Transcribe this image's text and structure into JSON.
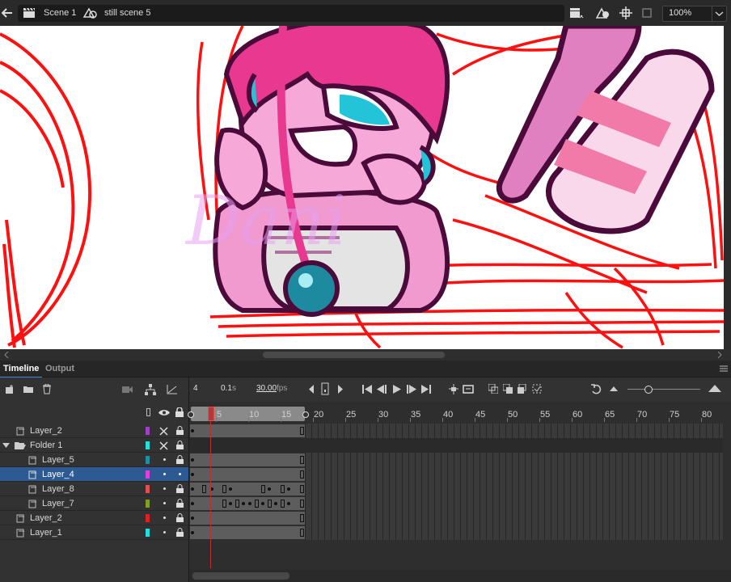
{
  "header": {
    "scene_label": "Scene 1",
    "symbol_label": "still scene 5",
    "zoom_value": "100%"
  },
  "stage": {
    "watermark": "Dani"
  },
  "tabs": [
    {
      "label": "Timeline",
      "active": true
    },
    {
      "label": "Output",
      "active": false
    }
  ],
  "timeline": {
    "current_frame": "4",
    "elapsed_time": "0.1",
    "time_unit": "s",
    "frame_rate": "30.00",
    "fps_unit": "fps",
    "ruler_ticks": [
      "5",
      "10",
      "15",
      "20",
      "25",
      "30",
      "35",
      "40",
      "45",
      "50",
      "55",
      "60",
      "65",
      "70",
      "75",
      "80"
    ],
    "layers": [
      {
        "name": "Layer_2",
        "indent": 0,
        "type": "layer",
        "color": "#a040c8",
        "visibility": "x",
        "lock": true,
        "selected": false
      },
      {
        "name": "Folder 1",
        "indent": 0,
        "type": "folder",
        "color": "#20e0e0",
        "visibility": "x",
        "lock": true,
        "selected": false
      },
      {
        "name": "Layer_5",
        "indent": 1,
        "type": "layer",
        "color": "#2090a0",
        "visibility": "dot",
        "lock": true,
        "selected": false
      },
      {
        "name": "Layer_4",
        "indent": 1,
        "type": "layer",
        "color": "#e040e0",
        "visibility": "dot",
        "lock": false,
        "selected": true
      },
      {
        "name": "Layer_8",
        "indent": 1,
        "type": "layer",
        "color": "#e05050",
        "visibility": "dot",
        "lock": true,
        "selected": false
      },
      {
        "name": "Layer_7",
        "indent": 1,
        "type": "layer",
        "color": "#80a020",
        "visibility": "dot",
        "lock": true,
        "selected": false
      },
      {
        "name": "Layer_2",
        "indent": 0,
        "type": "layer",
        "color": "#e02020",
        "visibility": "dot",
        "lock": true,
        "selected": false
      },
      {
        "name": "Layer_1",
        "indent": 0,
        "type": "layer",
        "color": "#20e0e0",
        "visibility": "dot",
        "lock": true,
        "selected": false
      }
    ]
  },
  "colors": {
    "accent_selected": "#2d5a92",
    "playhead": "#c0302a",
    "stage_bg": "#ffffff"
  }
}
